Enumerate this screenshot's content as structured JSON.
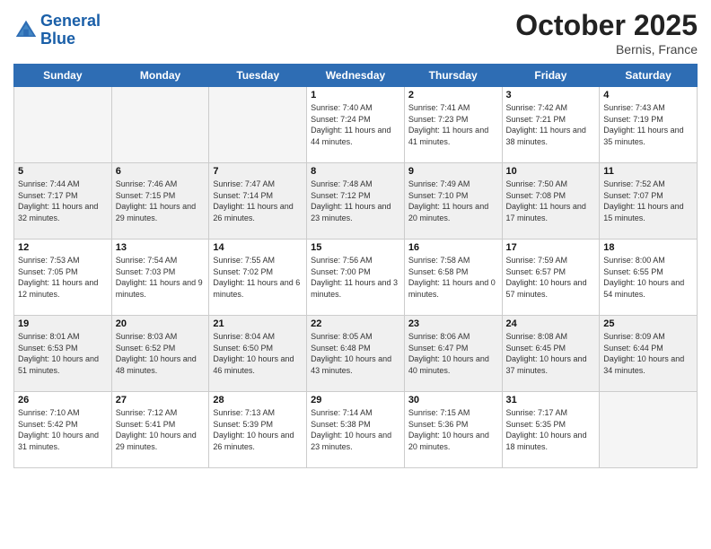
{
  "header": {
    "logo": {
      "line1": "General",
      "line2": "Blue"
    },
    "title": "October 2025",
    "location": "Bernis, France"
  },
  "weekdays": [
    "Sunday",
    "Monday",
    "Tuesday",
    "Wednesday",
    "Thursday",
    "Friday",
    "Saturday"
  ],
  "weeks": [
    [
      {
        "day": "",
        "sunrise": "",
        "sunset": "",
        "daylight": "",
        "empty": true
      },
      {
        "day": "",
        "sunrise": "",
        "sunset": "",
        "daylight": "",
        "empty": true
      },
      {
        "day": "",
        "sunrise": "",
        "sunset": "",
        "daylight": "",
        "empty": true
      },
      {
        "day": "1",
        "sunrise": "Sunrise: 7:40 AM",
        "sunset": "Sunset: 7:24 PM",
        "daylight": "Daylight: 11 hours and 44 minutes.",
        "empty": false
      },
      {
        "day": "2",
        "sunrise": "Sunrise: 7:41 AM",
        "sunset": "Sunset: 7:23 PM",
        "daylight": "Daylight: 11 hours and 41 minutes.",
        "empty": false
      },
      {
        "day": "3",
        "sunrise": "Sunrise: 7:42 AM",
        "sunset": "Sunset: 7:21 PM",
        "daylight": "Daylight: 11 hours and 38 minutes.",
        "empty": false
      },
      {
        "day": "4",
        "sunrise": "Sunrise: 7:43 AM",
        "sunset": "Sunset: 7:19 PM",
        "daylight": "Daylight: 11 hours and 35 minutes.",
        "empty": false
      }
    ],
    [
      {
        "day": "5",
        "sunrise": "Sunrise: 7:44 AM",
        "sunset": "Sunset: 7:17 PM",
        "daylight": "Daylight: 11 hours and 32 minutes.",
        "empty": false
      },
      {
        "day": "6",
        "sunrise": "Sunrise: 7:46 AM",
        "sunset": "Sunset: 7:15 PM",
        "daylight": "Daylight: 11 hours and 29 minutes.",
        "empty": false
      },
      {
        "day": "7",
        "sunrise": "Sunrise: 7:47 AM",
        "sunset": "Sunset: 7:14 PM",
        "daylight": "Daylight: 11 hours and 26 minutes.",
        "empty": false
      },
      {
        "day": "8",
        "sunrise": "Sunrise: 7:48 AM",
        "sunset": "Sunset: 7:12 PM",
        "daylight": "Daylight: 11 hours and 23 minutes.",
        "empty": false
      },
      {
        "day": "9",
        "sunrise": "Sunrise: 7:49 AM",
        "sunset": "Sunset: 7:10 PM",
        "daylight": "Daylight: 11 hours and 20 minutes.",
        "empty": false
      },
      {
        "day": "10",
        "sunrise": "Sunrise: 7:50 AM",
        "sunset": "Sunset: 7:08 PM",
        "daylight": "Daylight: 11 hours and 17 minutes.",
        "empty": false
      },
      {
        "day": "11",
        "sunrise": "Sunrise: 7:52 AM",
        "sunset": "Sunset: 7:07 PM",
        "daylight": "Daylight: 11 hours and 15 minutes.",
        "empty": false
      }
    ],
    [
      {
        "day": "12",
        "sunrise": "Sunrise: 7:53 AM",
        "sunset": "Sunset: 7:05 PM",
        "daylight": "Daylight: 11 hours and 12 minutes.",
        "empty": false
      },
      {
        "day": "13",
        "sunrise": "Sunrise: 7:54 AM",
        "sunset": "Sunset: 7:03 PM",
        "daylight": "Daylight: 11 hours and 9 minutes.",
        "empty": false
      },
      {
        "day": "14",
        "sunrise": "Sunrise: 7:55 AM",
        "sunset": "Sunset: 7:02 PM",
        "daylight": "Daylight: 11 hours and 6 minutes.",
        "empty": false
      },
      {
        "day": "15",
        "sunrise": "Sunrise: 7:56 AM",
        "sunset": "Sunset: 7:00 PM",
        "daylight": "Daylight: 11 hours and 3 minutes.",
        "empty": false
      },
      {
        "day": "16",
        "sunrise": "Sunrise: 7:58 AM",
        "sunset": "Sunset: 6:58 PM",
        "daylight": "Daylight: 11 hours and 0 minutes.",
        "empty": false
      },
      {
        "day": "17",
        "sunrise": "Sunrise: 7:59 AM",
        "sunset": "Sunset: 6:57 PM",
        "daylight": "Daylight: 10 hours and 57 minutes.",
        "empty": false
      },
      {
        "day": "18",
        "sunrise": "Sunrise: 8:00 AM",
        "sunset": "Sunset: 6:55 PM",
        "daylight": "Daylight: 10 hours and 54 minutes.",
        "empty": false
      }
    ],
    [
      {
        "day": "19",
        "sunrise": "Sunrise: 8:01 AM",
        "sunset": "Sunset: 6:53 PM",
        "daylight": "Daylight: 10 hours and 51 minutes.",
        "empty": false
      },
      {
        "day": "20",
        "sunrise": "Sunrise: 8:03 AM",
        "sunset": "Sunset: 6:52 PM",
        "daylight": "Daylight: 10 hours and 48 minutes.",
        "empty": false
      },
      {
        "day": "21",
        "sunrise": "Sunrise: 8:04 AM",
        "sunset": "Sunset: 6:50 PM",
        "daylight": "Daylight: 10 hours and 46 minutes.",
        "empty": false
      },
      {
        "day": "22",
        "sunrise": "Sunrise: 8:05 AM",
        "sunset": "Sunset: 6:48 PM",
        "daylight": "Daylight: 10 hours and 43 minutes.",
        "empty": false
      },
      {
        "day": "23",
        "sunrise": "Sunrise: 8:06 AM",
        "sunset": "Sunset: 6:47 PM",
        "daylight": "Daylight: 10 hours and 40 minutes.",
        "empty": false
      },
      {
        "day": "24",
        "sunrise": "Sunrise: 8:08 AM",
        "sunset": "Sunset: 6:45 PM",
        "daylight": "Daylight: 10 hours and 37 minutes.",
        "empty": false
      },
      {
        "day": "25",
        "sunrise": "Sunrise: 8:09 AM",
        "sunset": "Sunset: 6:44 PM",
        "daylight": "Daylight: 10 hours and 34 minutes.",
        "empty": false
      }
    ],
    [
      {
        "day": "26",
        "sunrise": "Sunrise: 7:10 AM",
        "sunset": "Sunset: 5:42 PM",
        "daylight": "Daylight: 10 hours and 31 minutes.",
        "empty": false
      },
      {
        "day": "27",
        "sunrise": "Sunrise: 7:12 AM",
        "sunset": "Sunset: 5:41 PM",
        "daylight": "Daylight: 10 hours and 29 minutes.",
        "empty": false
      },
      {
        "day": "28",
        "sunrise": "Sunrise: 7:13 AM",
        "sunset": "Sunset: 5:39 PM",
        "daylight": "Daylight: 10 hours and 26 minutes.",
        "empty": false
      },
      {
        "day": "29",
        "sunrise": "Sunrise: 7:14 AM",
        "sunset": "Sunset: 5:38 PM",
        "daylight": "Daylight: 10 hours and 23 minutes.",
        "empty": false
      },
      {
        "day": "30",
        "sunrise": "Sunrise: 7:15 AM",
        "sunset": "Sunset: 5:36 PM",
        "daylight": "Daylight: 10 hours and 20 minutes.",
        "empty": false
      },
      {
        "day": "31",
        "sunrise": "Sunrise: 7:17 AM",
        "sunset": "Sunset: 5:35 PM",
        "daylight": "Daylight: 10 hours and 18 minutes.",
        "empty": false
      },
      {
        "day": "",
        "sunrise": "",
        "sunset": "",
        "daylight": "",
        "empty": true
      }
    ]
  ]
}
